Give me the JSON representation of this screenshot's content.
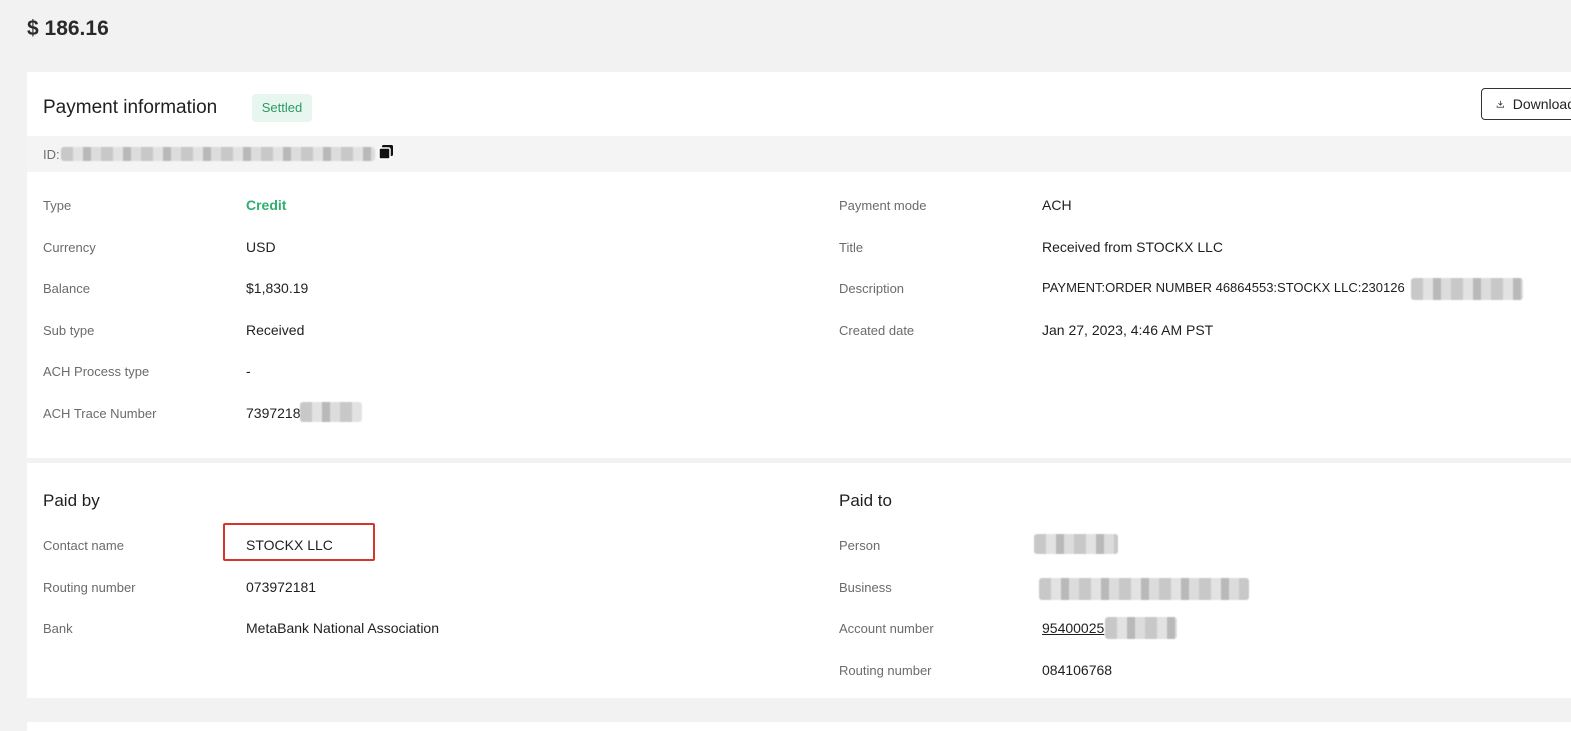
{
  "amount": "$ 186.16",
  "payment": {
    "title": "Payment information",
    "status": "Settled",
    "download_label": "Download",
    "id_label": "ID:"
  },
  "left_fields": [
    {
      "label": "Type",
      "value": "Credit"
    },
    {
      "label": "Currency",
      "value": "USD"
    },
    {
      "label": "Balance",
      "value": "$1,830.19"
    },
    {
      "label": "Sub type",
      "value": "Received"
    },
    {
      "label": "ACH Process type",
      "value": "-"
    },
    {
      "label": "ACH Trace Number",
      "value": "7397218"
    }
  ],
  "right_fields": [
    {
      "label": "Payment mode",
      "value": "ACH"
    },
    {
      "label": "Title",
      "value": "Received from STOCKX LLC"
    },
    {
      "label": "Description",
      "value": "PAYMENT:ORDER NUMBER 46864553:STOCKX LLC:230126"
    },
    {
      "label": "Created date",
      "value": "Jan 27, 2023, 4:46 AM PST"
    }
  ],
  "paid_by": {
    "title": "Paid by",
    "fields": [
      {
        "label": "Contact name",
        "value": "STOCKX LLC"
      },
      {
        "label": "Routing number",
        "value": "073972181"
      },
      {
        "label": "Bank",
        "value": "MetaBank National Association"
      }
    ]
  },
  "paid_to": {
    "title": "Paid to",
    "fields": [
      {
        "label": "Person",
        "value": ""
      },
      {
        "label": "Business",
        "value": ""
      },
      {
        "label": "Account number",
        "value": "95400025"
      },
      {
        "label": "Routing number",
        "value": "084106768"
      }
    ]
  },
  "colors": {
    "status_green": "#2e9a63",
    "credit_green": "#2fae72",
    "highlight_red": "#d9342b"
  }
}
